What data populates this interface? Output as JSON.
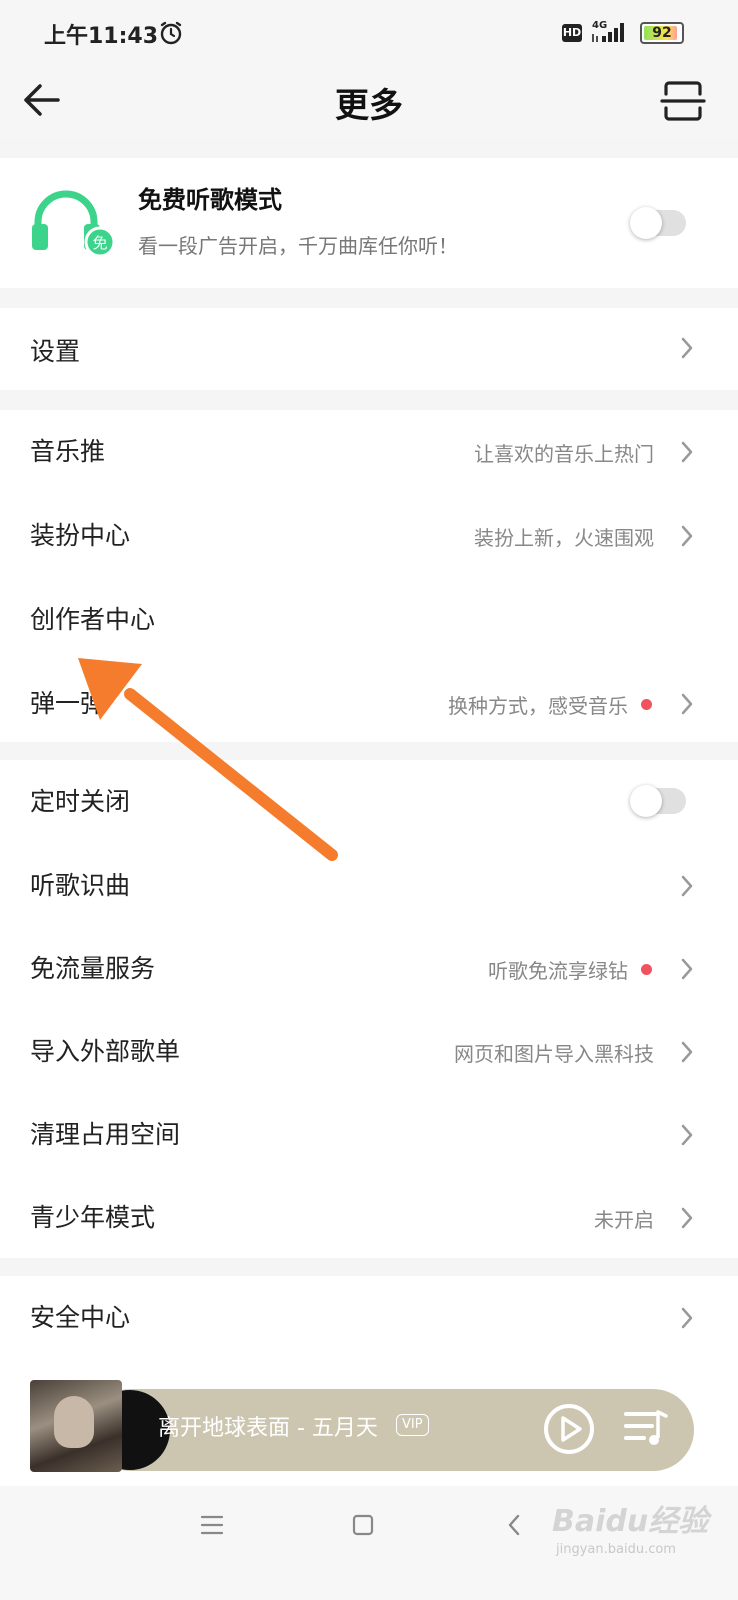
{
  "status_bar": {
    "time": "上午11:43",
    "hd": "HD",
    "network": "4G",
    "battery": "92",
    "battery_level": 0.92
  },
  "header": {
    "title": "更多"
  },
  "free_mode": {
    "title": "免费听歌模式",
    "subtitle": "看一段广告开启，千万曲库任你听！",
    "badge": "免",
    "enabled": false
  },
  "settings": {
    "label": "设置"
  },
  "group1": [
    {
      "label": "音乐推",
      "hint": "让喜欢的音乐上热门",
      "dot": false
    },
    {
      "label": "装扮中心",
      "hint": "装扮上新，火速围观",
      "dot": false
    },
    {
      "label": "创作者中心",
      "hint": "",
      "dot": false
    },
    {
      "label": "弹一弹",
      "hint": "换种方式，感受音乐",
      "dot": true
    }
  ],
  "group2": {
    "timer": {
      "label": "定时关闭",
      "enabled": false
    },
    "items": [
      {
        "label": "听歌识曲",
        "hint": "",
        "dot": false
      },
      {
        "label": "免流量服务",
        "hint": "听歌免流享绿钻",
        "dot": true
      },
      {
        "label": "导入外部歌单",
        "hint": "网页和图片导入黑科技",
        "dot": false
      },
      {
        "label": "清理占用空间",
        "hint": "",
        "dot": false
      },
      {
        "label": "青少年模式",
        "hint": "未开启",
        "dot": false
      }
    ]
  },
  "group3": [
    {
      "label": "安全中心"
    }
  ],
  "player": {
    "track": "离开地球表面 - 五月天",
    "vip": "VIP"
  },
  "watermark": {
    "text": "Baidu经验",
    "sub": "jingyan.baidu.com"
  },
  "colors": {
    "accent_green": "#3cd38a",
    "arrow_orange": "#f47c2c",
    "dot_red": "#f0535f"
  }
}
